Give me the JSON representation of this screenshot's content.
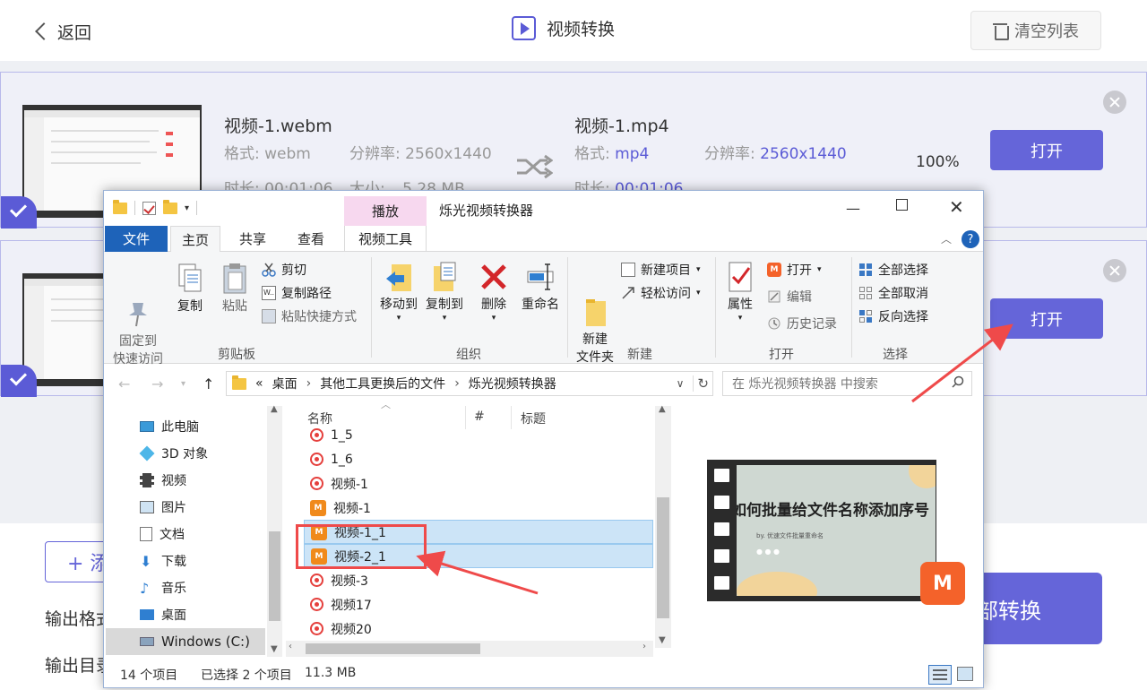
{
  "app": {
    "back_label": "返回",
    "title": "视频转换",
    "clear_label": "清空列表",
    "accent": "#6565d9"
  },
  "cards": [
    {
      "src_name": "视频-1.webm",
      "format_label": "格式:",
      "format_value": "webm",
      "res_label": "分辨率:",
      "res_value": "2560x1440",
      "duration_label": "时长:",
      "duration_value": "00:01:06",
      "size_label": "大小:",
      "size_value": "5.28 MB",
      "dst_name": "视频-1.mp4",
      "dst_format_value": "mp4",
      "dst_res_value": "2560x1440",
      "dst_duration_value": "00:01:06",
      "progress": "100%",
      "open_label": "打开"
    },
    {
      "open_label": "打开"
    }
  ],
  "bottom": {
    "add_partial": "+ 添",
    "output_format_label": "输出格式",
    "output_dir_label": "输出目录",
    "convert_all_label": "部转换"
  },
  "explorer": {
    "context_tab": "播放",
    "window_title": "烁光视频转换器",
    "tabs": [
      "文件",
      "主页",
      "共享",
      "查看",
      "视频工具"
    ],
    "ribbon": {
      "clipboard": {
        "pin": "固定到\n快速访问",
        "copy": "复制",
        "paste": "粘贴",
        "cut": "剪切",
        "copy_path": "复制路径",
        "paste_shortcut": "粘贴快捷方式",
        "group": "剪贴板"
      },
      "organize": {
        "move_to": "移动到",
        "copy_to": "复制到",
        "delete": "删除",
        "rename": "重命名",
        "group": "组织"
      },
      "new": {
        "new_folder": "新建\n文件夹",
        "new_item": "新建项目",
        "easy_access": "轻松访问",
        "group": "新建"
      },
      "open": {
        "properties": "属性",
        "open": "打开",
        "edit": "编辑",
        "history": "历史记录",
        "group": "打开"
      },
      "select": {
        "select_all": "全部选择",
        "select_none": "全部取消",
        "invert": "反向选择",
        "group": "选择"
      }
    },
    "address": {
      "prefix": "«",
      "crumbs": [
        "桌面",
        "其他工具更换后的文件",
        "烁光视频转换器"
      ],
      "search_placeholder": "在 烁光视频转换器 中搜索"
    },
    "nav": [
      {
        "label": "此电脑",
        "icon": "pc-icon"
      },
      {
        "label": "3D 对象",
        "icon": "cube-icon"
      },
      {
        "label": "视频",
        "icon": "video-folder-icon"
      },
      {
        "label": "图片",
        "icon": "picture-folder-icon"
      },
      {
        "label": "文档",
        "icon": "document-folder-icon"
      },
      {
        "label": "下载",
        "icon": "download-icon"
      },
      {
        "label": "音乐",
        "icon": "music-icon"
      },
      {
        "label": "桌面",
        "icon": "desktop-icon"
      },
      {
        "label": "Windows (C:)",
        "icon": "drive-icon"
      }
    ],
    "columns": [
      "名称",
      "#",
      "标题"
    ],
    "files": [
      {
        "name": "1_5",
        "type": "red",
        "selected": false
      },
      {
        "name": "1_6",
        "type": "red",
        "selected": false
      },
      {
        "name": "视频-1",
        "type": "red",
        "selected": false
      },
      {
        "name": "视频-1",
        "type": "orange",
        "selected": false
      },
      {
        "name": "视频-1_1",
        "type": "orange",
        "selected": true
      },
      {
        "name": "视频-2_1",
        "type": "orange",
        "selected": true
      },
      {
        "name": "视频-3",
        "type": "red",
        "selected": false
      },
      {
        "name": "视频17",
        "type": "red",
        "selected": false
      },
      {
        "name": "视频20",
        "type": "red",
        "selected": false
      }
    ],
    "preview": {
      "slide_title": "如何批量给文件名称添加序号",
      "slide_sub": "by. 优速文件批量重命名",
      "logo_text": "M"
    },
    "status": {
      "count": "14 个项目",
      "selected": "已选择 2 个项目",
      "size": "11.3 MB"
    }
  }
}
